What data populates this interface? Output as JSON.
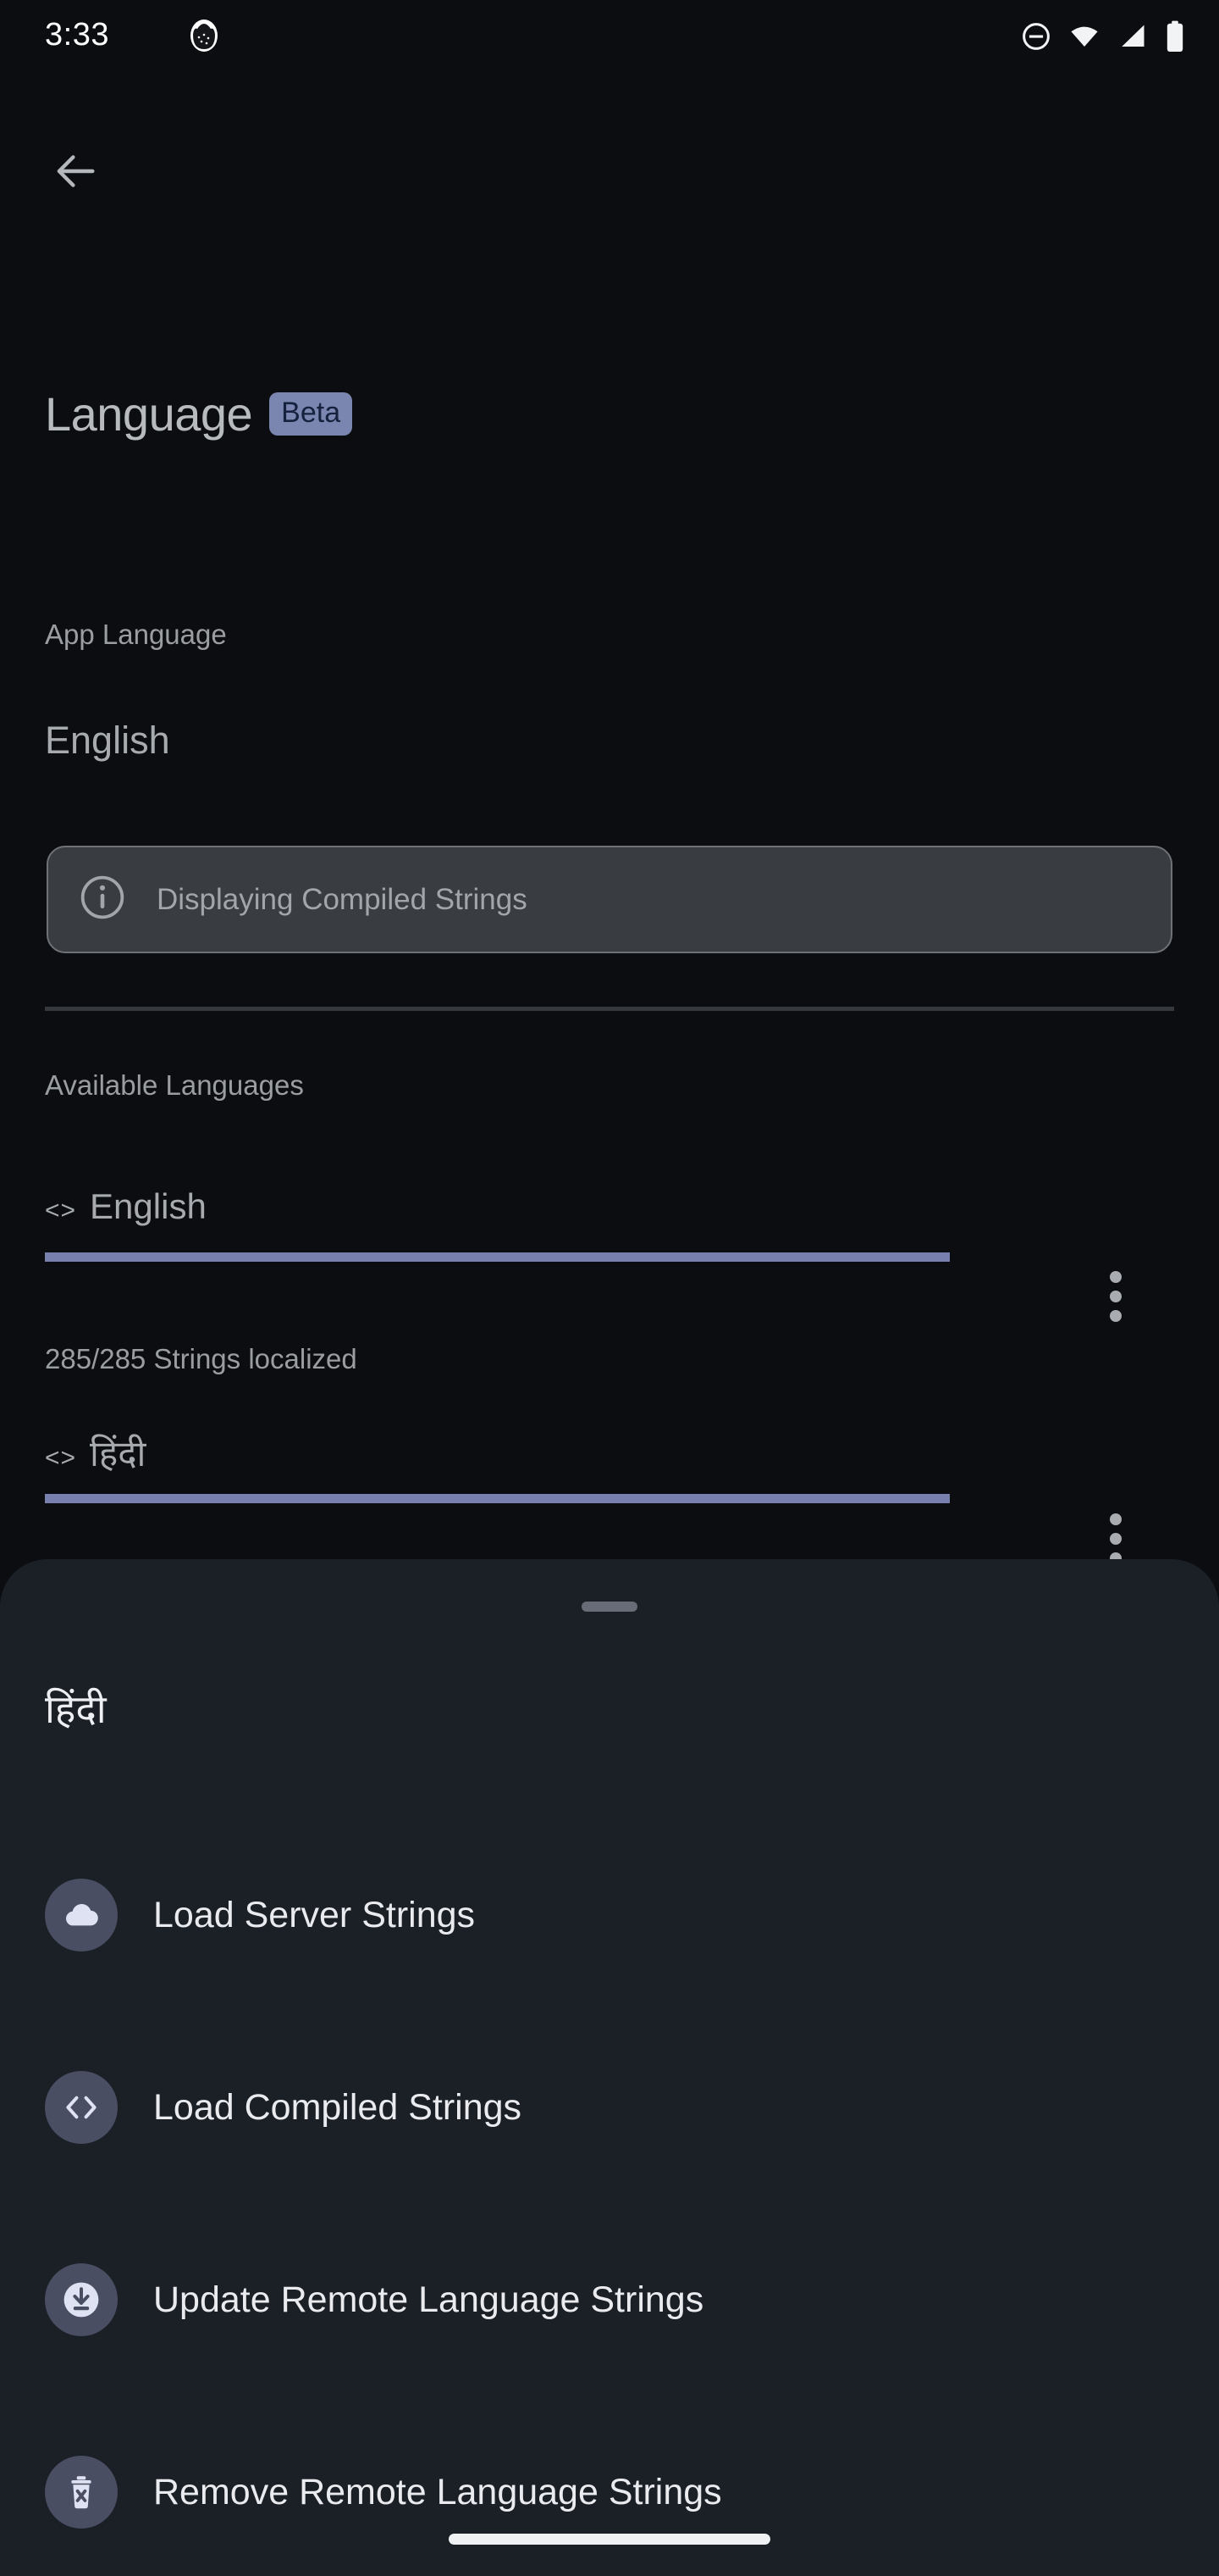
{
  "status_bar": {
    "time": "3:33",
    "app_icon": "cat-app-icon",
    "icons": [
      "dnd-icon",
      "wifi-icon",
      "signal-icon",
      "battery-icon"
    ]
  },
  "nav": {
    "back_icon": "back-arrow-icon"
  },
  "header": {
    "title": "Language",
    "badge": "Beta",
    "badge_bg": "#7A85B0",
    "badge_fg": "#16213E"
  },
  "app_language": {
    "label": "App Language",
    "value": "English"
  },
  "info_banner": {
    "icon": "info-icon",
    "text": "Displaying Compiled Strings"
  },
  "available": {
    "label": "Available Languages",
    "languages": [
      {
        "code_glyph": "<>",
        "name": "English",
        "progress_percent": 100,
        "status": "285/285 Strings localized",
        "progress_color": "#7881AD"
      },
      {
        "code_glyph": "<>",
        "name": "हिंदी",
        "progress_percent": 100,
        "status": "",
        "progress_color": "#7881AD"
      }
    ]
  },
  "bottom_sheet": {
    "handle": "drag-handle",
    "title": "हिंदी",
    "items": [
      {
        "icon": "cloud-icon",
        "label": "Load Server Strings"
      },
      {
        "icon": "code-icon",
        "label": "Load Compiled Strings"
      },
      {
        "icon": "download-icon",
        "label": "Update Remote Language Strings"
      },
      {
        "icon": "trash-x-icon",
        "label": "Remove Remote Language Strings"
      }
    ]
  },
  "system": {
    "home_indicator": "home-indicator"
  }
}
